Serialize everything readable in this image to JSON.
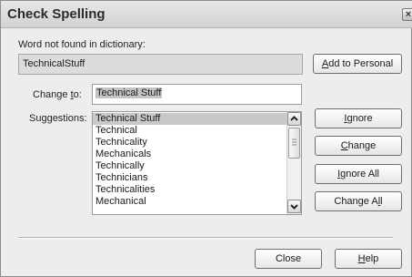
{
  "window": {
    "title": "Check Spelling"
  },
  "not_found": {
    "label": "Word not found in dictionary:",
    "value": "TechnicalStuff"
  },
  "change_to": {
    "label_prefix": "Change ",
    "label_mnemonic": "t",
    "label_suffix": "o:",
    "value": "Technical Stuff"
  },
  "suggestions": {
    "label": "Suggestions:",
    "items": [
      "Technical Stuff",
      "Technical",
      "Technicality",
      "Mechanicals",
      "Technically",
      "Technicians",
      "Technicalities",
      "Mechanical"
    ],
    "selected_index": 0
  },
  "buttons": {
    "add_to_personal": {
      "mnemonic": "A",
      "rest": "dd to Personal"
    },
    "ignore": {
      "mnemonic": "I",
      "rest": "gnore"
    },
    "change": {
      "mnemonic": "C",
      "rest": "hange"
    },
    "ignore_all": {
      "mnemonic": "I",
      "rest": "gnore All"
    },
    "change_all": {
      "pre": "Change A",
      "mnemonic": "l",
      "rest": "l"
    },
    "close": {
      "label": "Close"
    },
    "help": {
      "mnemonic": "H",
      "rest": "elp"
    }
  }
}
